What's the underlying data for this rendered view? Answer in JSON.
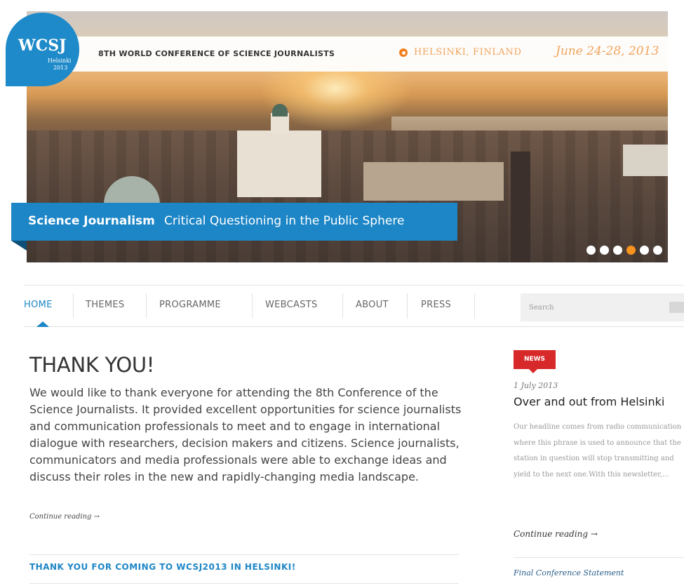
{
  "header": {
    "logo": {
      "main": "WCSJ",
      "city": "Helsinki",
      "year": "2013"
    },
    "conference_title": "8TH WORLD CONFERENCE OF SCIENCE JOURNALISTS",
    "location": "HELSINKI, FINLAND",
    "dates": "June 24-28, 2013"
  },
  "hero": {
    "tagline_strong": "Science Journalism",
    "tagline_rest": "Critical Questioning in the Public Sphere",
    "slide_count": 6,
    "active_slide": 4
  },
  "nav": {
    "items": [
      "HOME",
      "THEMES",
      "PROGRAMME",
      "WEBCASTS",
      "ABOUT",
      "PRESS"
    ],
    "active": "HOME"
  },
  "search": {
    "placeholder": "Search"
  },
  "main": {
    "title": "THANK YOU!",
    "body": "We would like to thank everyone for attending the 8th Conference of the Science Journalists. It provided excellent opportunities for science journalists and communication professionals to meet and to engage in international dialogue with researchers, decision makers and citizens. Science journalists, communicators and media professionals were able to exchange ideas and discuss their roles in the new and rapidly-changing media landscape.",
    "continue": "Continue reading →",
    "sub_heading": "THANK YOU FOR COMING TO WCSJ2013 IN HELSINKI!"
  },
  "sidebar": {
    "badge": "NEWS",
    "date": "1 July 2013",
    "title": "Over and out from Helsinki",
    "body": "Our headline comes from radio communication where this phrase is used to announce that the station in question will stop transmitting and yield to the next one.With this newsletter,...",
    "continue": "Continue reading →",
    "next_link": "Final Conference Statement"
  },
  "colors": {
    "accent_blue": "#1d86c6",
    "orange": "#f7931e",
    "gold": "#f0a45c",
    "news_red": "#d7282a"
  }
}
